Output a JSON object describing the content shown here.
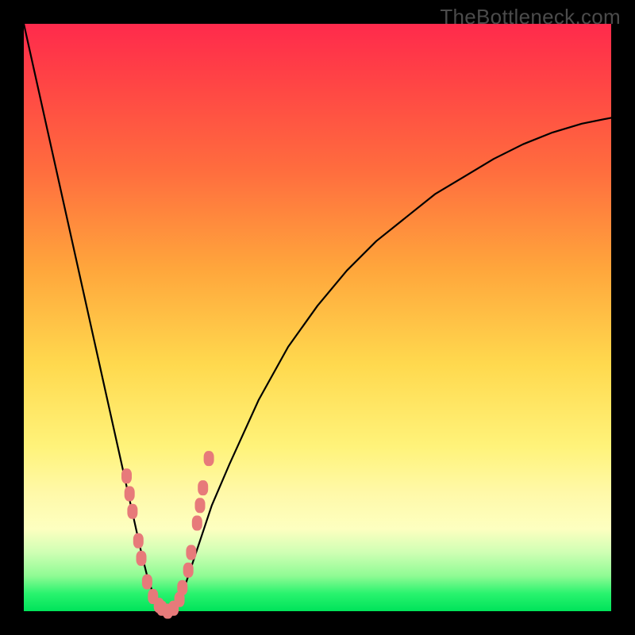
{
  "watermark": "TheBottleneck.com",
  "colors": {
    "gradient_top": "#ff2a4c",
    "gradient_mid1": "#ffa73c",
    "gradient_mid2": "#fff37a",
    "gradient_bottom": "#00e35a",
    "curve": "#000000",
    "points": "#e77a7a",
    "frame": "#000000"
  },
  "chart_data": {
    "type": "line",
    "title": "",
    "xlabel": "",
    "ylabel": "",
    "xlim": [
      0,
      100
    ],
    "ylim": [
      0,
      100
    ],
    "grid": false,
    "series": [
      {
        "name": "bottleneck-curve",
        "x": [
          0,
          2,
          4,
          6,
          8,
          10,
          12,
          14,
          16,
          18,
          20,
          21,
          22,
          23,
          24,
          25,
          26,
          27,
          28,
          30,
          32,
          35,
          40,
          45,
          50,
          55,
          60,
          65,
          70,
          75,
          80,
          85,
          90,
          95,
          100
        ],
        "y": [
          100,
          91,
          82,
          73,
          64,
          55,
          46,
          37,
          28,
          19,
          10,
          6,
          3,
          1,
          0,
          0,
          1,
          3,
          6,
          12,
          18,
          25,
          36,
          45,
          52,
          58,
          63,
          67,
          71,
          74,
          77,
          79.5,
          81.5,
          83,
          84
        ]
      }
    ],
    "highlight_points": {
      "name": "highlighted-data-points",
      "x": [
        17.5,
        18,
        18.5,
        19.5,
        20,
        21,
        22,
        23,
        23.5,
        24.5,
        25.5,
        26.5,
        27,
        28,
        28.5,
        29.5,
        30,
        30.5,
        31.5
      ],
      "y": [
        23,
        20,
        17,
        12,
        9,
        5,
        2.5,
        1,
        0.5,
        0,
        0.5,
        2,
        4,
        7,
        10,
        15,
        18,
        21,
        26
      ]
    }
  }
}
